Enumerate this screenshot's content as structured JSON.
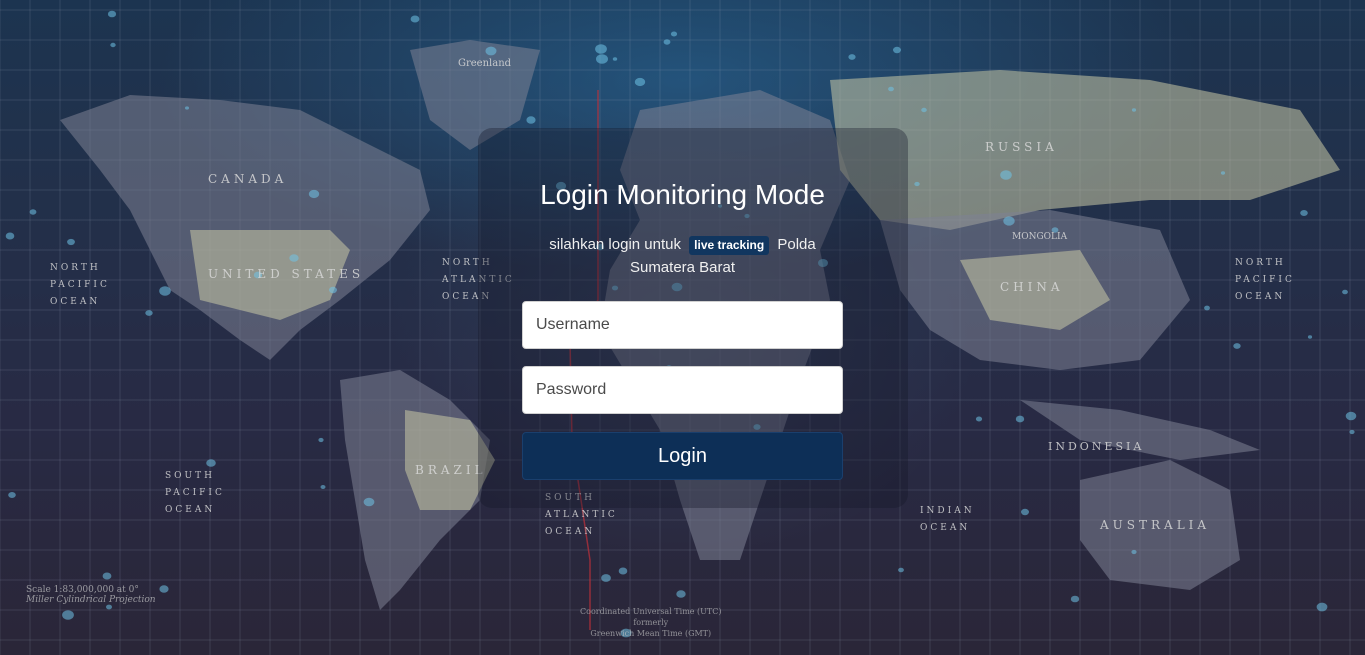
{
  "login": {
    "title": "Login Monitoring Mode",
    "subtitle_before": "silahkan login untuk",
    "badge": "live tracking",
    "subtitle_after": "Polda Sumatera Barat",
    "username_placeholder": "Username",
    "password_placeholder": "Password",
    "button_label": "Login"
  },
  "map_labels": {
    "canada": "CANADA",
    "united_states": "UNITED STATES",
    "russia": "RUSSIA",
    "china": "CHINA",
    "mongolia": "MONGOLIA",
    "brazil": "BRAZIL",
    "australia": "AUSTRALIA",
    "indonesia": "INDONESIA",
    "greenland": "Greenland",
    "north_pacific_left": "NORTH PACIFIC OCEAN",
    "north_pacific_right": "NORTH PACIFIC OCEAN",
    "north_atlantic": "NORTH ATLANTIC OCEAN",
    "south_pacific": "SOUTH PACIFIC OCEAN",
    "south_atlantic": "SOUTH ATLANTIC OCEAN",
    "indian_ocean": "INDIAN OCEAN",
    "scale": "Scale 1:83,000,000 at 0°",
    "projection": "Miller Cylindrical Projection",
    "utc_line1": "Coordinated Universal Time (UTC)",
    "utc_line2": "formerly",
    "utc_line3": "Greenwich Mean Time (GMT)"
  },
  "colors": {
    "button": "#0d2f57",
    "badge": "#11365f"
  }
}
